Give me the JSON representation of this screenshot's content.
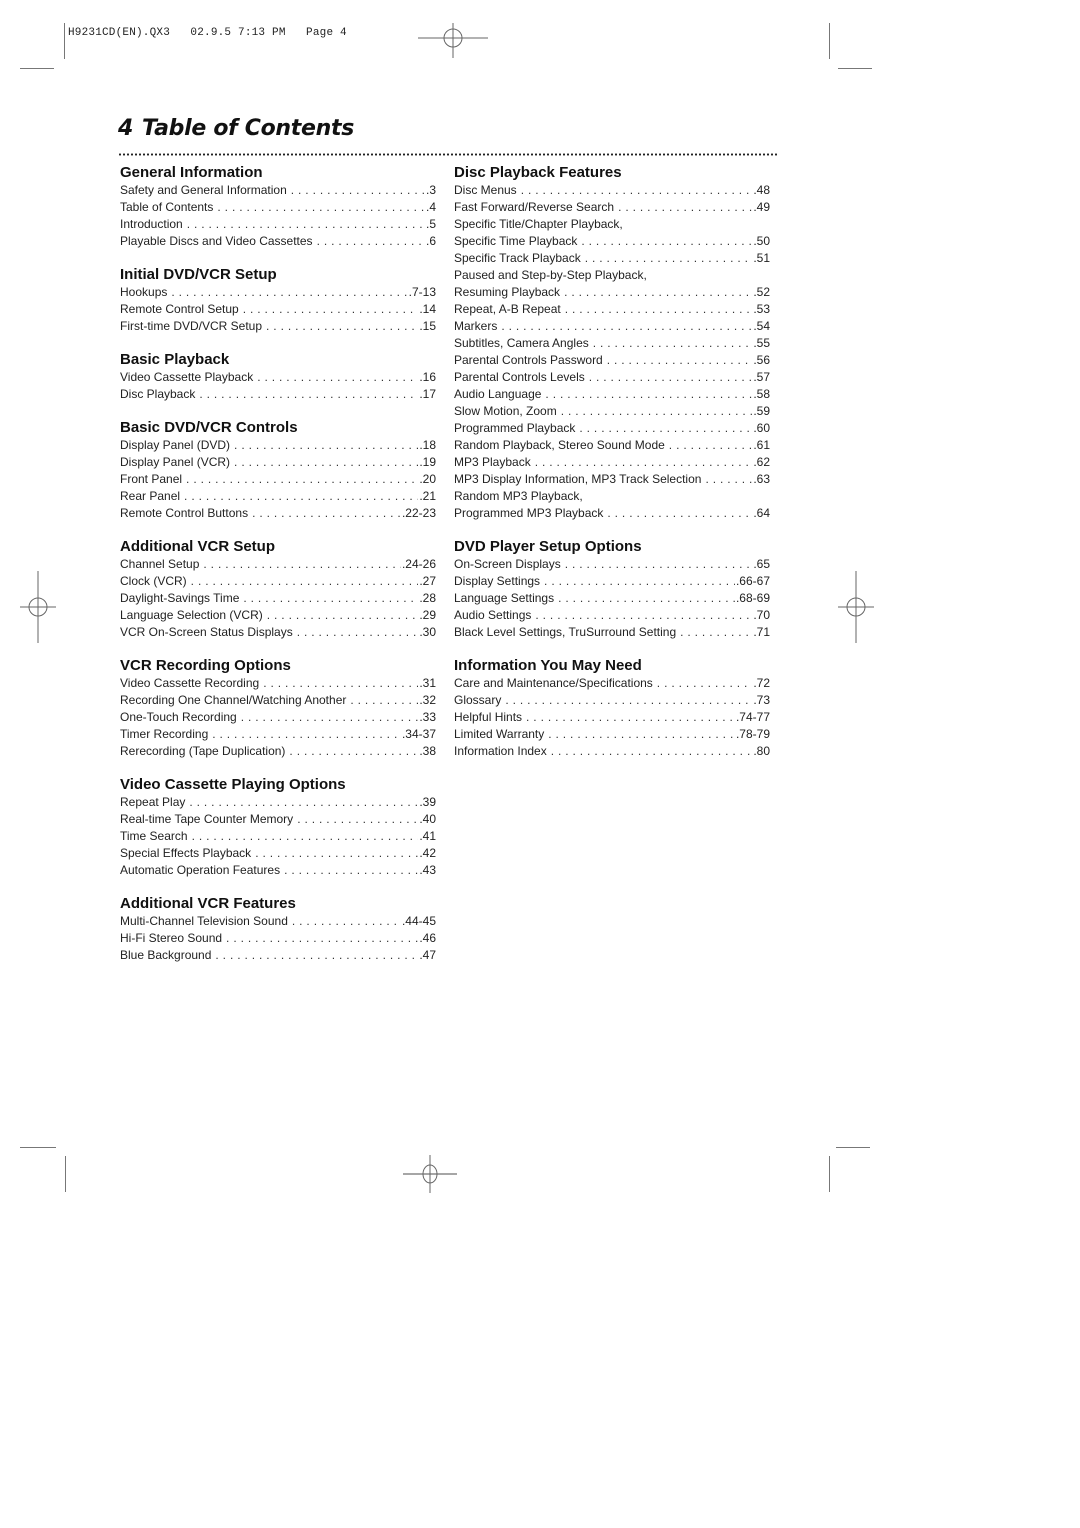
{
  "slug": "H9231CD(EN).QX3   02.9.5 7:13 PM   Page 4",
  "page_title": {
    "number": "4",
    "text": "Table of Contents"
  },
  "left_column": [
    {
      "title": "General Information",
      "entries": [
        {
          "label": "Safety and General Information",
          "page": ".3"
        },
        {
          "label": "Table of Contents",
          "page": ".4"
        },
        {
          "label": "Introduction",
          "page": ".5"
        },
        {
          "label": "Playable Discs and Video Cassettes",
          "page": ".6"
        }
      ]
    },
    {
      "title": "Initial DVD/VCR Setup",
      "entries": [
        {
          "label": "Hookups",
          "page": ".7-13"
        },
        {
          "label": "Remote Control Setup",
          "page": ".14"
        },
        {
          "label": "First-time DVD/VCR Setup",
          "page": ".15"
        }
      ]
    },
    {
      "title": "Basic Playback",
      "entries": [
        {
          "label": "Video Cassette Playback",
          "page": ".16"
        },
        {
          "label": "Disc Playback",
          "page": ".17"
        }
      ]
    },
    {
      "title": "Basic DVD/VCR Controls",
      "entries": [
        {
          "label": "Display Panel (DVD)",
          "page": ".18"
        },
        {
          "label": "Display Panel (VCR)",
          "page": ".19"
        },
        {
          "label": "Front Panel",
          "page": ".20"
        },
        {
          "label": "Rear Panel",
          "page": ".21"
        },
        {
          "label": "Remote Control Buttons",
          "page": ".22-23"
        }
      ]
    },
    {
      "title": "Additional VCR Setup",
      "entries": [
        {
          "label": "Channel Setup",
          "page": ".24-26"
        },
        {
          "label": "Clock (VCR)",
          "page": ".27"
        },
        {
          "label": "Daylight-Savings Time",
          "page": ".28"
        },
        {
          "label": "Language Selection (VCR)",
          "page": ".29"
        },
        {
          "label": "VCR On-Screen Status Displays",
          "page": ".30"
        }
      ]
    },
    {
      "title": "VCR Recording Options",
      "entries": [
        {
          "label": "Video Cassette Recording",
          "page": ".31"
        },
        {
          "label": "Recording One Channel/Watching Another",
          "page": ".32"
        },
        {
          "label": "One-Touch Recording",
          "page": ".33"
        },
        {
          "label": "Timer Recording",
          "page": ".34-37"
        },
        {
          "label": "Rerecording (Tape Duplication)",
          "page": ".38"
        }
      ]
    },
    {
      "title": "Video Cassette Playing Options",
      "entries": [
        {
          "label": "Repeat Play",
          "page": ".39"
        },
        {
          "label": "Real-time Tape Counter Memory",
          "page": ".40"
        },
        {
          "label": "Time Search",
          "page": ".41"
        },
        {
          "label": "Special Effects Playback",
          "page": ".42"
        },
        {
          "label": "Automatic Operation Features",
          "page": ".43"
        }
      ]
    },
    {
      "title": "Additional VCR Features",
      "entries": [
        {
          "label": "Multi-Channel Television Sound",
          "page": ".44-45"
        },
        {
          "label": "Hi-Fi Stereo Sound",
          "page": ".46"
        },
        {
          "label": "Blue Background",
          "page": ".47"
        }
      ]
    }
  ],
  "right_column": [
    {
      "title": "Disc Playback Features",
      "entries": [
        {
          "label": "Disc Menus",
          "page": ".48"
        },
        {
          "label": "Fast Forward/Reverse Search",
          "page": ".49"
        },
        {
          "label": "Specific Title/Chapter Playback,",
          "page": ""
        },
        {
          "label": "Specific Time Playback",
          "page": ".50"
        },
        {
          "label": "Specific Track Playback",
          "page": ".51"
        },
        {
          "label": "Paused and Step-by-Step Playback,",
          "page": ""
        },
        {
          "label": "Resuming Playback",
          "page": ".52"
        },
        {
          "label": "Repeat, A-B Repeat",
          "page": ".53"
        },
        {
          "label": "Markers",
          "page": ".54"
        },
        {
          "label": "Subtitles, Camera Angles",
          "page": ".55"
        },
        {
          "label": "Parental Controls Password",
          "page": ".56"
        },
        {
          "label": "Parental Controls Levels",
          "page": ".57"
        },
        {
          "label": "Audio Language",
          "page": ".58"
        },
        {
          "label": "Slow Motion, Zoom",
          "page": ".59"
        },
        {
          "label": "Programmed Playback",
          "page": ".60"
        },
        {
          "label": "Random Playback, Stereo Sound Mode",
          "page": ".61"
        },
        {
          "label": "MP3 Playback",
          "page": ".62"
        },
        {
          "label": "MP3 Display Information, MP3 Track Selection",
          "page": ".63"
        },
        {
          "label": "Random MP3 Playback,",
          "page": ""
        },
        {
          "label": "Programmed MP3 Playback",
          "page": ".64"
        }
      ]
    },
    {
      "title": "DVD Player Setup Options",
      "entries": [
        {
          "label": "On-Screen Displays",
          "page": ".65"
        },
        {
          "label": "Display Settings",
          "page": ".66-67"
        },
        {
          "label": "Language Settings",
          "page": ".68-69"
        },
        {
          "label": "Audio Settings",
          "page": ".70"
        },
        {
          "label": "Black Level Settings, TruSurround Setting",
          "page": ".71"
        }
      ]
    },
    {
      "title": "Information You May Need",
      "entries": [
        {
          "label": "Care and Maintenance/Specifications",
          "page": ".72"
        },
        {
          "label": "Glossary",
          "page": ".73"
        },
        {
          "label": "Helpful Hints",
          "page": ".74-77"
        },
        {
          "label": "Limited Warranty",
          "page": ".78-79"
        },
        {
          "label": "Information Index",
          "page": ".80"
        }
      ]
    }
  ]
}
